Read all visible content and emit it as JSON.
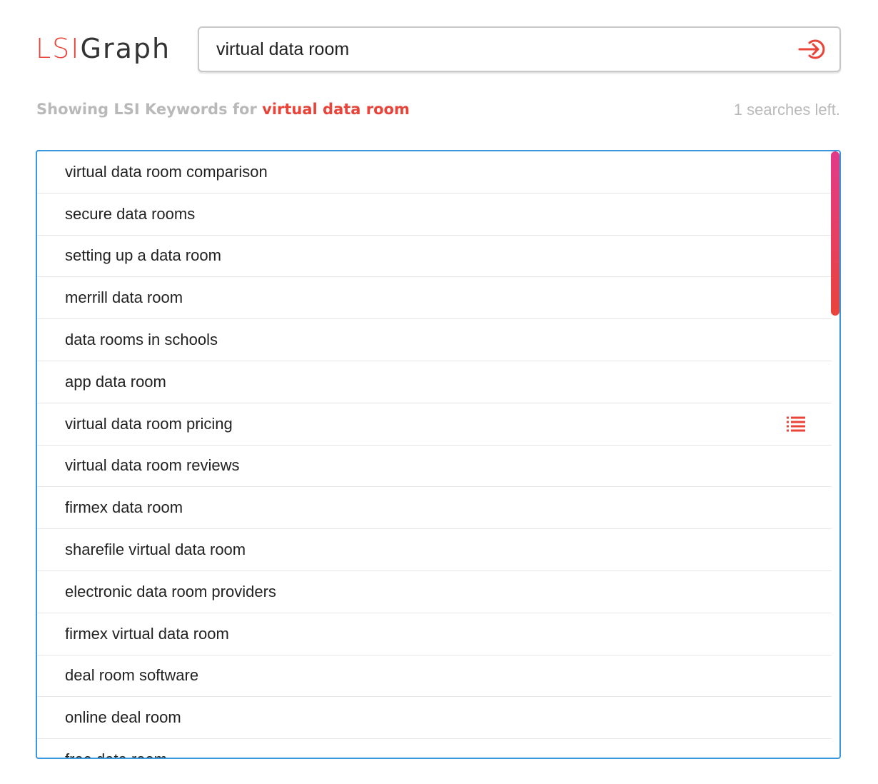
{
  "logo": {
    "part1": "LSI",
    "part2": "Graph"
  },
  "search": {
    "value": "virtual data room"
  },
  "status": {
    "prefix": "Showing LSI Keywords for ",
    "keyword": "virtual data room",
    "searches_left": "1 searches left."
  },
  "results": [
    "virtual data room comparison",
    "secure data rooms",
    "setting up a data room",
    "merrill data room",
    "data rooms in schools",
    "app data room",
    "virtual data room pricing",
    "virtual data room reviews",
    "firmex data room",
    "sharefile virtual data room",
    "electronic data room providers",
    "firmex virtual data room",
    "deal room software",
    "online deal room",
    "free data room"
  ],
  "hover_row_index": 6,
  "colors": {
    "accent": "#e8443a",
    "border_focus": "#3a96dd",
    "muted": "#b9b9b9"
  },
  "icons": {
    "submit": "login-arrow-icon",
    "row_action": "list-icon"
  }
}
